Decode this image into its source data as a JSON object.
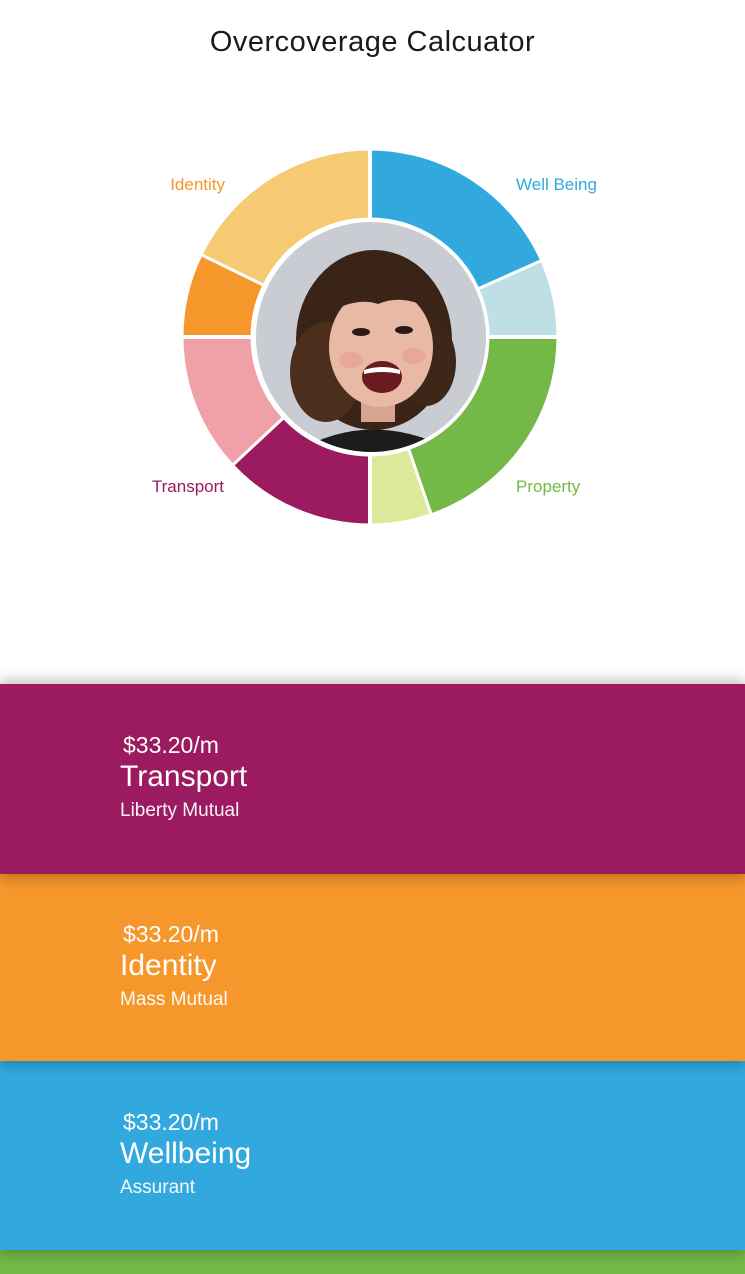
{
  "page": {
    "title": "Overcoverage Calcuator"
  },
  "chart": {
    "labels": {
      "identity": "Identity",
      "wellbeing": "Well Being",
      "transport": "Transport",
      "property": "Property"
    },
    "colors": {
      "identity": "#f5972a",
      "identity_light": "#f6ca72",
      "wellbeing": "#31a9de",
      "wellbeing_light": "#bfdfe7",
      "transport": "#9c1a60",
      "transport_light": "#efa1a7",
      "property": "#74b848",
      "property_light": "#dde99a"
    }
  },
  "cards": [
    {
      "price": "$33.20/m",
      "name": "Transport",
      "provider": "Liberty Mutual",
      "color": "#9c1a60"
    },
    {
      "price": "$33.20/m",
      "name": "Identity",
      "provider": "Mass Mutual",
      "color": "#f5972a"
    },
    {
      "price": "$33.20/m",
      "name": "Wellbeing",
      "provider": "Assurant",
      "color": "#31a9de"
    },
    {
      "color": "#74b848"
    }
  ]
}
